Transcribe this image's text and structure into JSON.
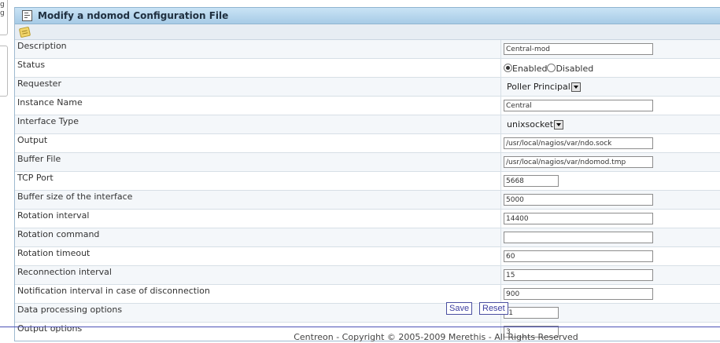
{
  "left_fragments": [
    "g",
    "g"
  ],
  "form": {
    "title": "Modify a ndomod Configuration File",
    "rows": [
      {
        "label": "Description",
        "type": "text",
        "value": "Central-mod",
        "size": "wide"
      },
      {
        "label": "Status",
        "type": "radio",
        "options": [
          "Enabled",
          "Disabled"
        ],
        "selected": "Enabled"
      },
      {
        "label": "Requester",
        "type": "select",
        "value": "Poller Principal"
      },
      {
        "label": "Instance Name",
        "type": "text",
        "value": "Central",
        "size": "wide"
      },
      {
        "label": "Interface Type",
        "type": "select",
        "value": "unixsocket"
      },
      {
        "label": "Output",
        "type": "text",
        "value": "/usr/local/nagios/var/ndo.sock",
        "size": "wide"
      },
      {
        "label": "Buffer File",
        "type": "text",
        "value": "/usr/local/nagios/var/ndomod.tmp",
        "size": "wide"
      },
      {
        "label": "TCP Port",
        "type": "text",
        "value": "5668",
        "size": "short"
      },
      {
        "label": "Buffer size of the interface",
        "type": "text",
        "value": "5000",
        "size": "wide"
      },
      {
        "label": "Rotation interval",
        "type": "text",
        "value": "14400",
        "size": "wide"
      },
      {
        "label": "Rotation command",
        "type": "text",
        "value": "",
        "size": "wide"
      },
      {
        "label": "Rotation timeout",
        "type": "text",
        "value": "60",
        "size": "wide"
      },
      {
        "label": "Reconnection interval",
        "type": "text",
        "value": "15",
        "size": "wide"
      },
      {
        "label": "Notification interval in case of disconnection",
        "type": "text",
        "value": "900",
        "size": "wide"
      },
      {
        "label": "Data processing options",
        "type": "text",
        "value": "-1",
        "size": "short"
      },
      {
        "label": "Output options",
        "type": "text",
        "value": "3",
        "size": "short"
      }
    ]
  },
  "buttons": {
    "save": "Save",
    "reset": "Reset"
  },
  "footer": "Centreon - Copyright © 2005-2009 Merethis - All Rights Reserved",
  "icons": {
    "title": "form-icon",
    "subbar": "note-icon"
  },
  "colors": {
    "title_bar": "#a7cbe6",
    "button_text": "#3e3fa1",
    "footer_line": "#4b52b5"
  }
}
